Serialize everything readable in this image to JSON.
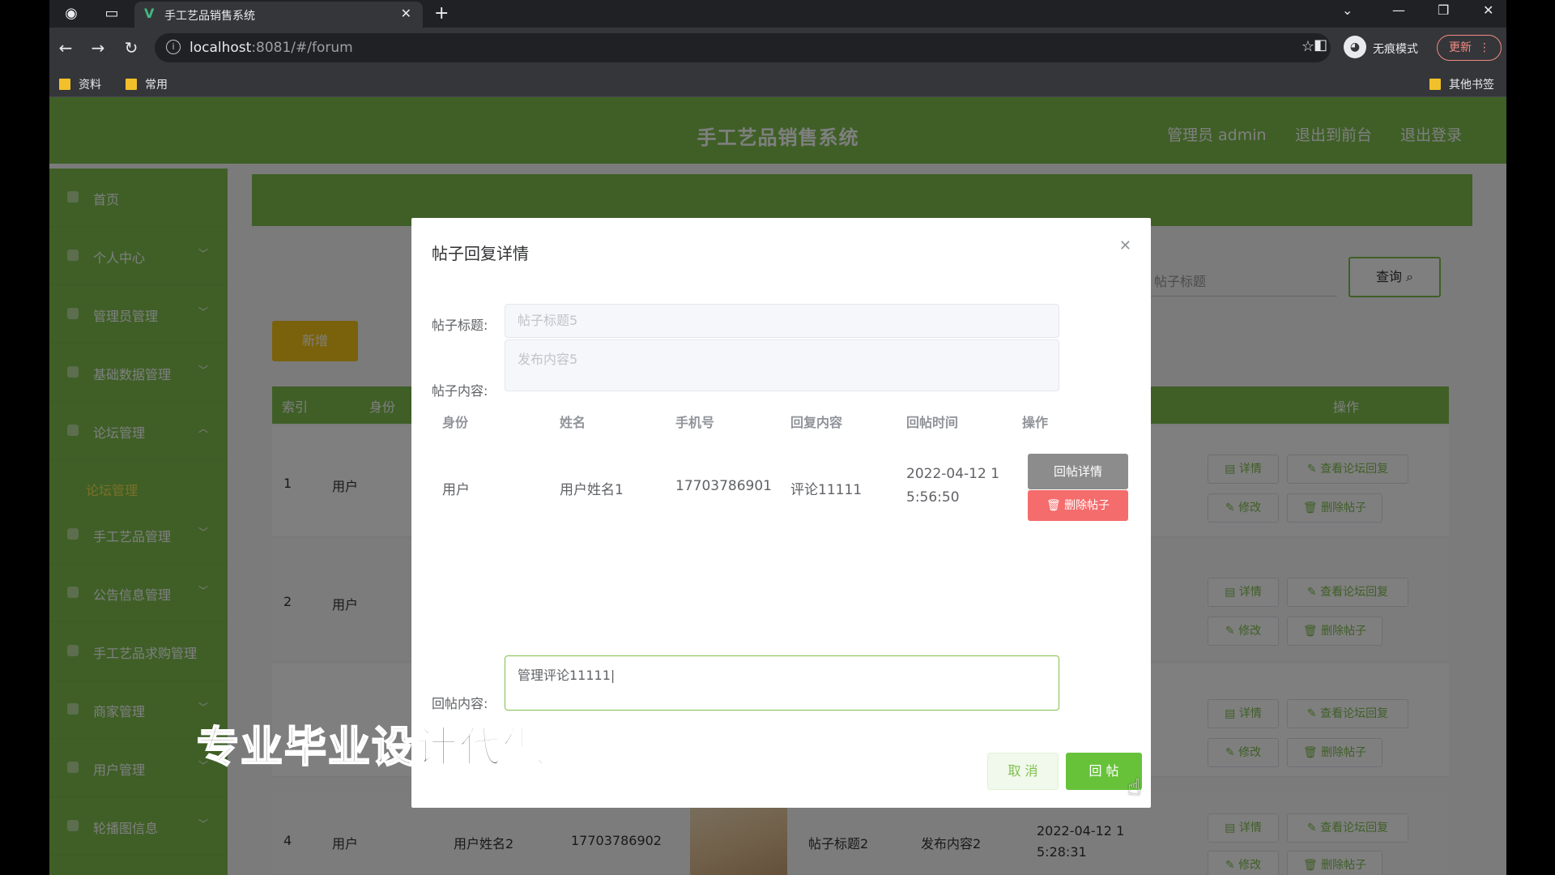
{
  "browser": {
    "tab_title": "手工艺品销售系统",
    "tab_favicon": "V",
    "url_host": "localhost",
    "url_rest": ":8081/#/forum",
    "incognito_label": "无痕模式",
    "update_label": "更新",
    "bookmarks": [
      "资料",
      "常用"
    ],
    "other_bookmarks": "其他书签"
  },
  "header": {
    "title": "手工艺品销售系统",
    "admin_label": "管理员 admin",
    "back_front_label": "退出到前台",
    "logout_label": "退出登录"
  },
  "sidebar": {
    "items": [
      {
        "label": "首页"
      },
      {
        "label": "个人中心"
      },
      {
        "label": "管理员管理"
      },
      {
        "label": "基础数据管理"
      },
      {
        "label": "论坛管理"
      },
      {
        "label": "手工艺品管理"
      },
      {
        "label": "公告信息管理"
      },
      {
        "label": "手工艺品求购管理"
      },
      {
        "label": "商家管理"
      },
      {
        "label": "用户管理"
      },
      {
        "label": "轮播图信息"
      }
    ],
    "active_sub": "论坛管理"
  },
  "main": {
    "search_placeholder": "帖子标题",
    "query_label": "查询",
    "add_label": "新增",
    "headers": {
      "index": "索引",
      "identity": "身份",
      "actions": "操作"
    },
    "rows": [
      {
        "index": "1",
        "identity": "用户"
      },
      {
        "index": "2",
        "identity": "用户"
      },
      {
        "index": "4",
        "identity": "用户",
        "name": "用户姓名2",
        "phone": "17703786902",
        "title": "帖子标题2",
        "content": "发布内容2",
        "time": "2022-04-12 1",
        "time2": "5:28:31"
      }
    ],
    "op_buttons": {
      "detail": "详情",
      "view_reply": "查看论坛回复",
      "edit": "修改",
      "delete": "删除帖子"
    }
  },
  "dialog": {
    "title": "帖子回复详情",
    "post_title_label": "帖子标题:",
    "post_title_value": "帖子标题5",
    "post_content_label": "帖子内容:",
    "post_content_value": "发布内容5",
    "reply_table": {
      "headers": [
        "身份",
        "姓名",
        "手机号",
        "回复内容",
        "回帖时间",
        "操作"
      ],
      "rows": [
        {
          "identity": "用户",
          "name": "用户姓名1",
          "phone": "17703786901",
          "content": "评论11111",
          "time_line1": "2022-04-12 1",
          "time_line2": "5:56:50"
        }
      ],
      "detail_button": "回帖详情",
      "delete_button": "删除帖子"
    },
    "reply_label": "回帖内容:",
    "reply_value": "管理评论11111",
    "cancel_label": "取 消",
    "submit_label": "回 帖"
  },
  "watermark": "专业毕业设计代做",
  "colors": {
    "theme_green": "#7fbf4e",
    "button_green": "#67c23a",
    "danger": "#f56c6c",
    "warning": "#f5c518"
  }
}
